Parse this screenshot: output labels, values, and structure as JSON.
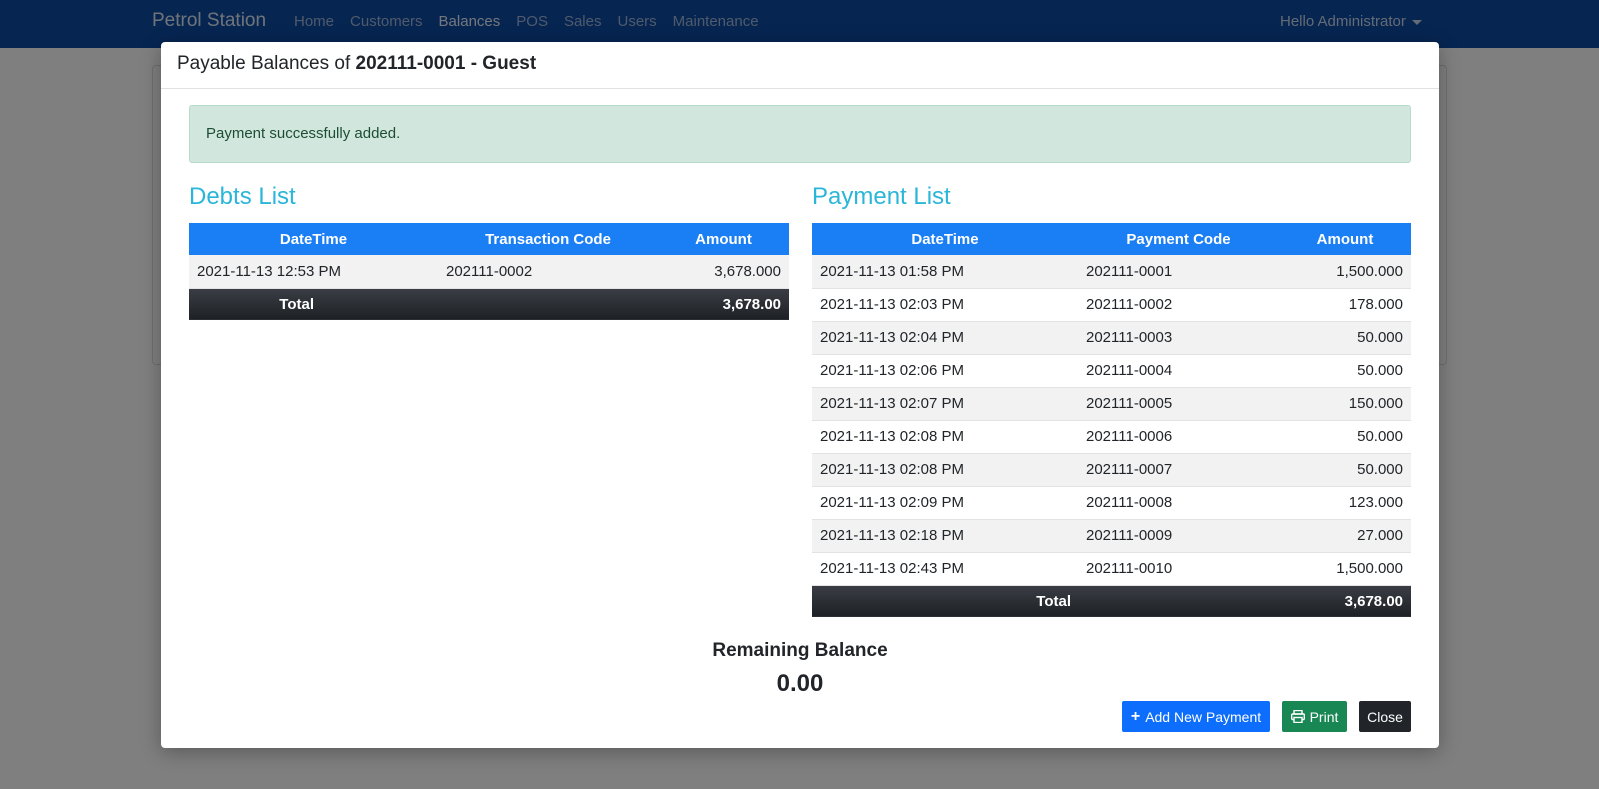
{
  "navbar": {
    "brand": "Petrol Station",
    "links": [
      "Home",
      "Customers",
      "Balances",
      "POS",
      "Sales",
      "Users",
      "Maintenance"
    ],
    "active": "Balances",
    "user_greeting": "Hello Administrator"
  },
  "modal": {
    "title_prefix": "Payable Balances of ",
    "title_code": "202111-0001 - Guest",
    "alert": "Payment successfully added.",
    "debts": {
      "title": "Debts List",
      "headers": [
        "DateTime",
        "Transaction Code",
        "Amount"
      ],
      "rows": [
        [
          "2021-11-13 12:53 PM",
          "202111-0002",
          "3,678.000"
        ]
      ],
      "total_label": "Total",
      "total_value": "3,678.00"
    },
    "payments": {
      "title": "Payment List",
      "headers": [
        "DateTime",
        "Payment Code",
        "Amount"
      ],
      "rows": [
        [
          "2021-11-13 01:58 PM",
          "202111-0001",
          "1,500.000"
        ],
        [
          "2021-11-13 02:03 PM",
          "202111-0002",
          "178.000"
        ],
        [
          "2021-11-13 02:04 PM",
          "202111-0003",
          "50.000"
        ],
        [
          "2021-11-13 02:06 PM",
          "202111-0004",
          "50.000"
        ],
        [
          "2021-11-13 02:07 PM",
          "202111-0005",
          "150.000"
        ],
        [
          "2021-11-13 02:08 PM",
          "202111-0006",
          "50.000"
        ],
        [
          "2021-11-13 02:08 PM",
          "202111-0007",
          "50.000"
        ],
        [
          "2021-11-13 02:09 PM",
          "202111-0008",
          "123.000"
        ],
        [
          "2021-11-13 02:18 PM",
          "202111-0009",
          "27.000"
        ],
        [
          "2021-11-13 02:43 PM",
          "202111-0010",
          "1,500.000"
        ]
      ],
      "total_label": "Total",
      "total_value": "3,678.00"
    },
    "remaining_label": "Remaining Balance",
    "remaining_value": "0.00",
    "buttons": {
      "add": "Add New Payment",
      "print": "Print",
      "close": "Close"
    }
  },
  "icons": {
    "add": "plus-icon",
    "print": "printer-icon",
    "user_menu": "caret-down-icon"
  }
}
